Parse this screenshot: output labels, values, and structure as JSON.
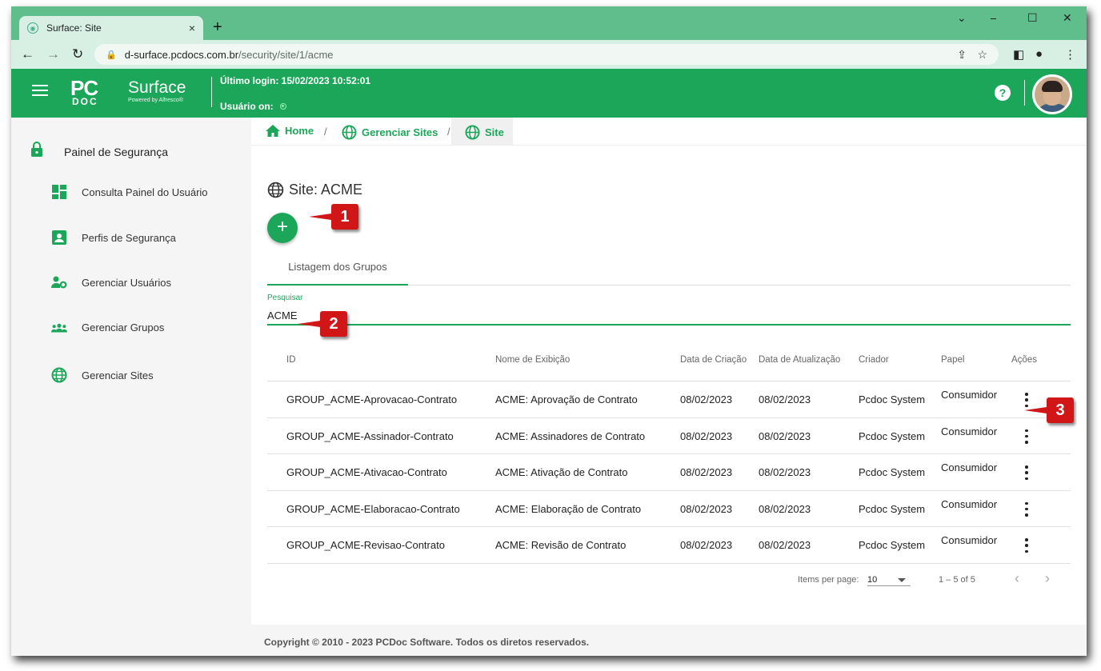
{
  "browser": {
    "tab_title": "Surface: Site",
    "tab_close": "×",
    "new_tab": "+",
    "url_host": "d-surface.pcdocs.com.br",
    "url_path": "/security/site/1/acme",
    "min": "⎯",
    "max": "☐",
    "close": "✕",
    "dropdown": "⌄"
  },
  "header": {
    "logo_pc": "PC",
    "logo_doc": "DOC",
    "logo_surface": "Surface",
    "logo_powered": "Powered by Alfresco®",
    "last_login": "Último login: 15/02/2023 10:52:01",
    "user_on": "Usuário on:",
    "help": "?"
  },
  "sidebar": {
    "title": "Painel de Segurança",
    "items": [
      {
        "label": "Consulta Painel do Usuário",
        "icon": "dashboard-icon"
      },
      {
        "label": "Perfis de Segurança",
        "icon": "profile-icon"
      },
      {
        "label": "Gerenciar Usuários",
        "icon": "users-gear-icon"
      },
      {
        "label": "Gerenciar Grupos",
        "icon": "groups-icon"
      },
      {
        "label": "Gerenciar Sites",
        "icon": "globe-icon"
      }
    ]
  },
  "breadcrumb": {
    "home": "Home",
    "sites": "Gerenciar Sites",
    "site": "Site",
    "sep": "/"
  },
  "page": {
    "title": "Site: ACME",
    "add": "+",
    "tab": "Listagem dos Grupos",
    "search_label": "Pesquisar",
    "search_value": "ACME"
  },
  "table": {
    "headers": [
      "ID",
      "Nome de Exibição",
      "Data de Criação",
      "Data de Atualização",
      "Criador",
      "Papel",
      "Ações"
    ],
    "rows": [
      {
        "id": "GROUP_ACME-Aprovacao-Contrato",
        "name": "ACME: Aprovação de Contrato",
        "created": "08/02/2023",
        "updated": "08/02/2023",
        "creator": "Pcdoc System",
        "role": "Consumidor"
      },
      {
        "id": "GROUP_ACME-Assinador-Contrato",
        "name": "ACME: Assinadores de Contrato",
        "created": "08/02/2023",
        "updated": "08/02/2023",
        "creator": "Pcdoc System",
        "role": "Consumidor"
      },
      {
        "id": "GROUP_ACME-Ativacao-Contrato",
        "name": "ACME: Ativação de Contrato",
        "created": "08/02/2023",
        "updated": "08/02/2023",
        "creator": "Pcdoc System",
        "role": "Consumidor"
      },
      {
        "id": "GROUP_ACME-Elaboracao-Contrato",
        "name": "ACME: Elaboração de Contrato",
        "created": "08/02/2023",
        "updated": "08/02/2023",
        "creator": "Pcdoc System",
        "role": "Consumidor"
      },
      {
        "id": "GROUP_ACME-Revisao-Contrato",
        "name": "ACME: Revisão de Contrato",
        "created": "08/02/2023",
        "updated": "08/02/2023",
        "creator": "Pcdoc System",
        "role": "Consumidor"
      }
    ]
  },
  "paginator": {
    "items_per_page": "Items per page:",
    "page_size": "10",
    "range": "1 – 5 of 5",
    "prev": "‹",
    "next": "›"
  },
  "footer": "Copyright © 2010 - 2023 PCDoc Software. Todos os diretos reservados.",
  "callouts": [
    "1",
    "2",
    "3"
  ],
  "colors": {
    "brand_green": "#1ca659",
    "chrome_green": "#5fbe8c",
    "callout_red": "#d01616"
  }
}
